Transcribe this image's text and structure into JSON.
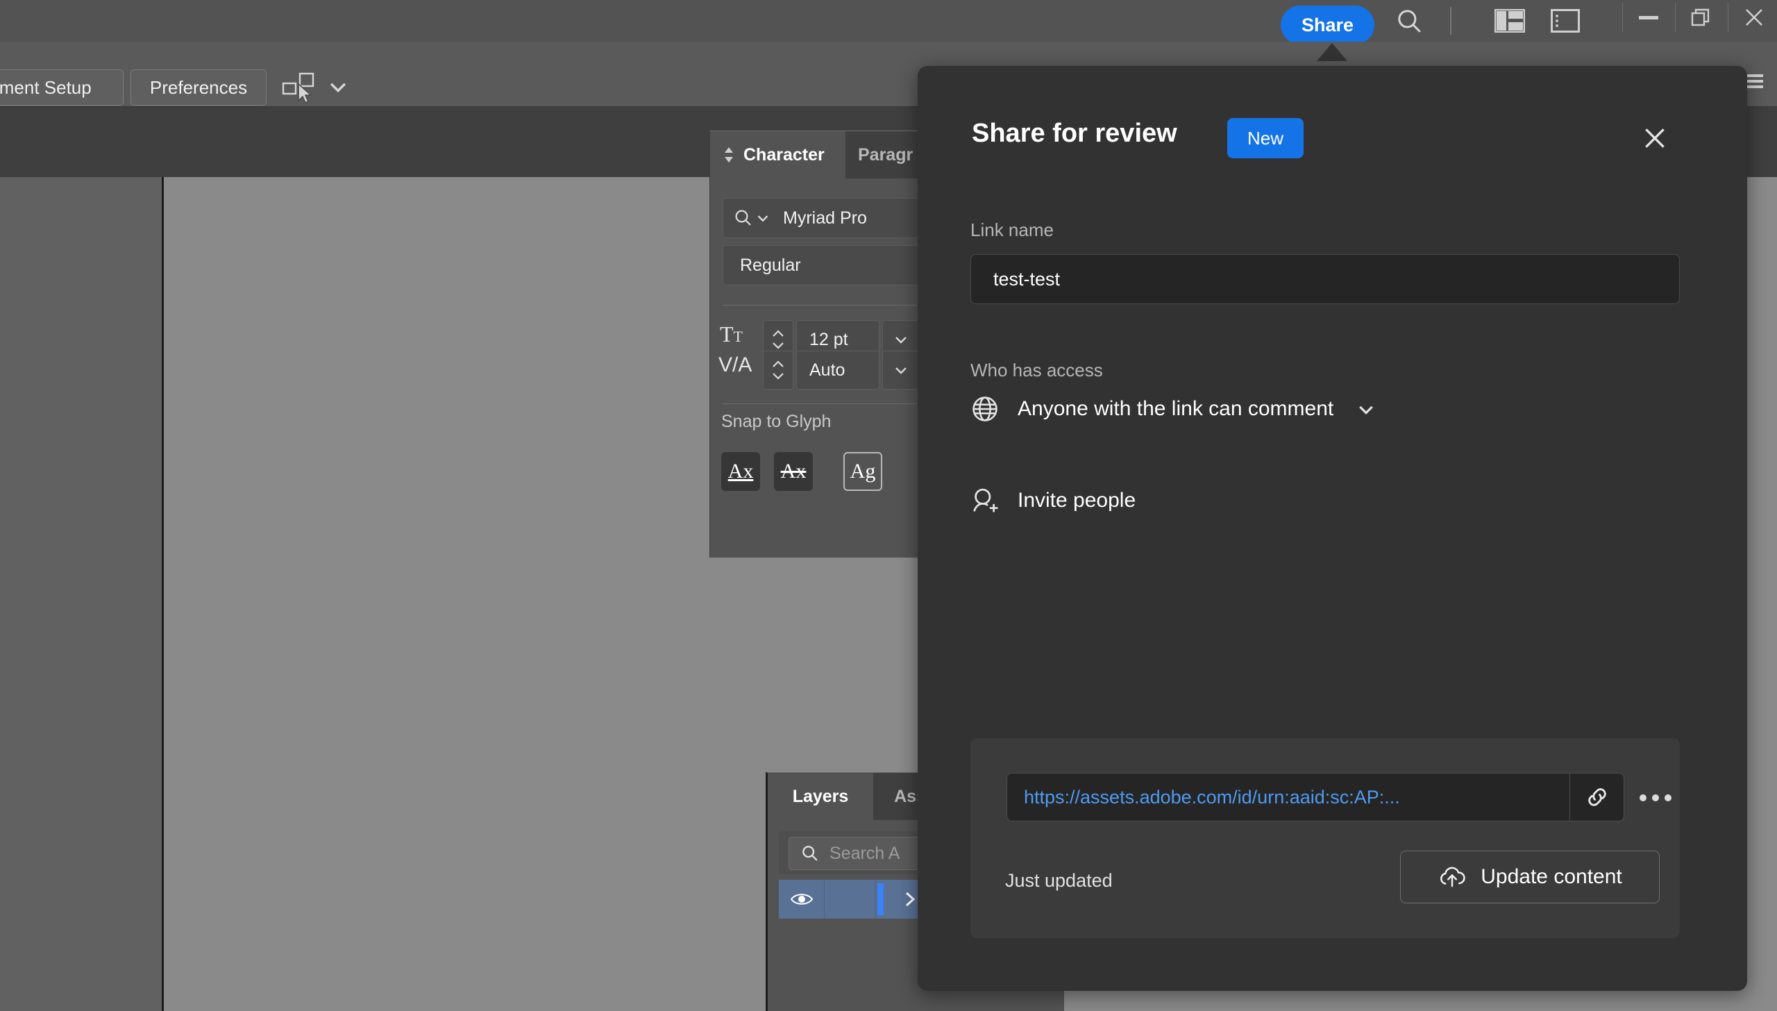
{
  "titlebar": {
    "share_label": "Share",
    "icons": {
      "search": "search-icon",
      "workspace_switch": "workspace-layout-icon",
      "properties_panel": "properties-panel-icon",
      "minimize": "minimize-icon",
      "restore": "restore-icon",
      "close": "close-icon"
    }
  },
  "menubar": {
    "document_setup_label": "ument Setup",
    "preferences_label": "Preferences",
    "selection_tool_icon": "select-similar-icon",
    "selection_dropdown_icon": "chevron-down-icon",
    "hamburger_icon": "hamburger-menu-icon",
    "overflow_chevrons": "»"
  },
  "character_panel": {
    "tabs": [
      {
        "label": "Character",
        "active": true
      },
      {
        "label": "Paragr",
        "active": false
      }
    ],
    "collapse_icon": "expand-collapse-icon",
    "font_family": {
      "search_icon": "font-search-icon",
      "dropdown_icon": "chevron-down-icon",
      "value": "Myriad Pro"
    },
    "font_style": {
      "value": "Regular"
    },
    "font_size": {
      "icon": "font-size-icon",
      "value": "12 pt",
      "dropdown_icon": "chevron-down-icon"
    },
    "leading": {
      "icon": "leading-icon",
      "value": "Auto",
      "dropdown_icon": "chevron-down-icon"
    },
    "snap_to_glyph": {
      "label": "Snap to Glyph",
      "buttons": [
        {
          "glyph": "Ax",
          "name": "snap-baseline-icon",
          "state": "filled"
        },
        {
          "glyph": "Ax",
          "name": "snap-x-height-icon",
          "state": "filled"
        },
        {
          "glyph": "Ag",
          "name": "snap-bounding-box-icon",
          "state": "outline"
        }
      ]
    }
  },
  "layers_panel": {
    "tabs": [
      {
        "label": "Layers",
        "active": true
      },
      {
        "label": "Asse",
        "active": false
      }
    ],
    "search": {
      "icon": "search-icon",
      "placeholder": "Search A"
    },
    "row": {
      "visibility_icon": "eye-icon",
      "expand_icon": "chevron-right-icon",
      "color_swatch": "#3b82f6"
    }
  },
  "share_dialog": {
    "title": "Share for review",
    "new_badge": "New",
    "close_icon": "close-icon",
    "link_name_label": "Link name",
    "link_name_value": "test-test",
    "who_has_access_label": "Who has access",
    "access_icon": "globe-icon",
    "access_value": "Anyone with the link can comment",
    "access_dropdown_icon": "chevron-down-icon",
    "invite_icon": "add-person-icon",
    "invite_label": "Invite people",
    "link_url": "https://assets.adobe.com/id/urn:aaid:sc:AP:...",
    "copy_link_icon": "link-chain-icon",
    "more_options_icon": "more-horizontal-icon",
    "status_text": "Just updated",
    "update_button_label": "Update content",
    "update_button_icon": "cloud-upload-icon"
  },
  "colors": {
    "accent_blue": "#1473e6",
    "link_blue": "#4f9bf0",
    "dialog_bg": "#323232",
    "panel_bg": "#535353",
    "canvas_bg": "#8a8a8a",
    "selection_blue": "#5a7196"
  }
}
